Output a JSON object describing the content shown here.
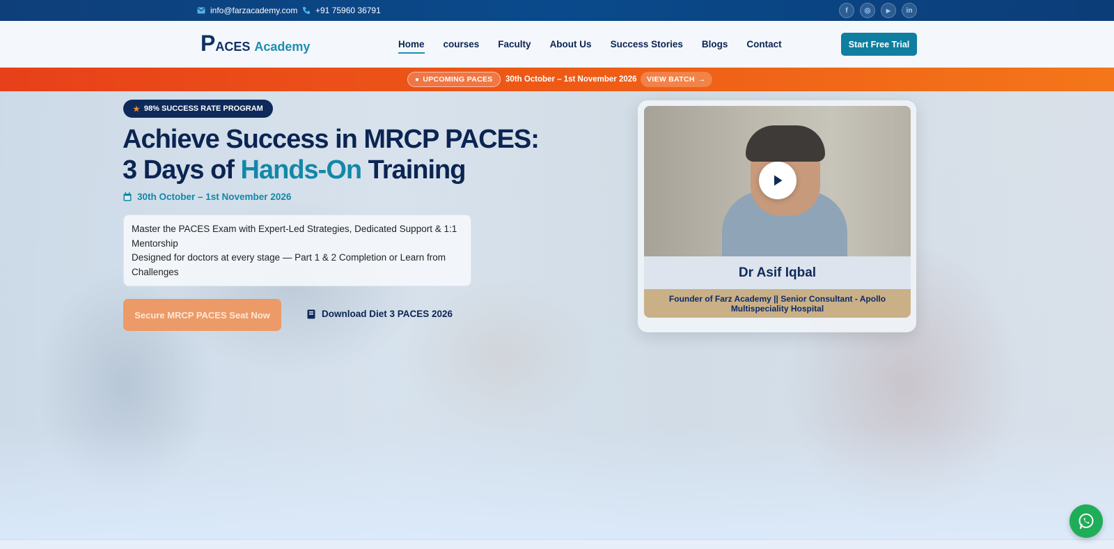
{
  "topbar": {
    "email": "info@farzacademy.com",
    "phone": "+91 75960 36791",
    "socials": [
      {
        "name": "facebook",
        "glyph": "f"
      },
      {
        "name": "instagram",
        "glyph": "◎"
      },
      {
        "name": "youtube",
        "glyph": "▶"
      },
      {
        "name": "linkedin",
        "glyph": "in"
      }
    ]
  },
  "header": {
    "logo": {
      "p": "P",
      "aces": "ACES",
      "academy": "Academy"
    },
    "nav": [
      "Home",
      "courses",
      "Faculty",
      "About Us",
      "Success Stories",
      "Blogs",
      "Contact"
    ],
    "active_nav": "Home",
    "cta": "Start Free Trial"
  },
  "banner": {
    "badge": "UPCOMING PACES",
    "date": "30th October – 1st November 2026",
    "button": "VIEW BATCH"
  },
  "hero": {
    "pill": "98% SUCCESS RATE PROGRAM",
    "headline_part1": "Achieve Success in MRCP PACES: 3 Days of ",
    "headline_highlight": "Hands-On",
    "headline_part2": " Training",
    "date": "30th October – 1st November 2026",
    "desc_line1": "Master the PACES Exam with Expert-Led Strategies, Dedicated Support & 1:1 Mentorship",
    "desc_line2": "Designed for doctors at every stage — Part 1 & 2 Completion or Learn from Challenges",
    "primary_cta": "Secure MRCP PACES Seat Now",
    "secondary_cta": "Download Diet 3 PACES 2026"
  },
  "video_card": {
    "name": "Dr Asif Iqbal",
    "role": "Founder of Farz Academy || Senior Consultant - Apollo Multispeciality Hospital"
  },
  "colors": {
    "navy": "#0b2452",
    "teal": "#1387a8",
    "orange_banner": "#ee5a16",
    "cta_orange": "#ec9a68",
    "whatsapp": "#1fae57"
  }
}
